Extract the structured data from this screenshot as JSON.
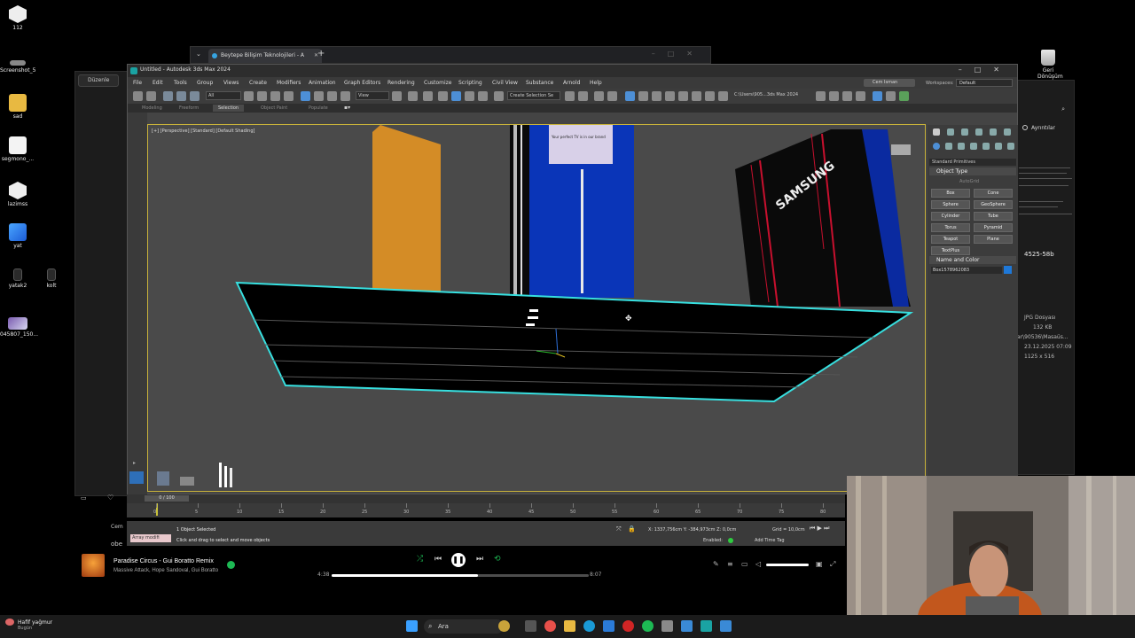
{
  "desktop": {
    "icons": [
      {
        "label": "112"
      },
      {
        "label": "Screenshot_5"
      },
      {
        "label": "sad"
      },
      {
        "label": "segmono_..."
      },
      {
        "label": "lazimss"
      },
      {
        "label": "yat"
      },
      {
        "label": "yatak2"
      },
      {
        "label": "kolt"
      },
      {
        "label": "045807_150..."
      }
    ],
    "recycle_bin": "Geri Dönüşüm"
  },
  "browser": {
    "tab_title": "Beytepe Bilişim Teknolojileri - A",
    "close": "✕",
    "new_tab": "+"
  },
  "explorer": {
    "button": "Düzenle"
  },
  "viewer": {
    "details": "Ayrıntılar",
    "size_label": "4525-58b",
    "file_type": "JPG Dosyası",
    "file_size": "132 KB",
    "path": "ar\\90536\\Masaüs...",
    "date": "23.12.2025 07:09",
    "dimensions": "1125 x 516"
  },
  "max": {
    "title": "Untitled - Autodesk 3ds Max 2024",
    "menu": [
      "File",
      "Edit",
      "Tools",
      "Group",
      "Views",
      "Create",
      "Modifiers",
      "Animation",
      "Graph Editors",
      "Rendering",
      "Customize",
      "Scripting",
      "Civil View",
      "Substance",
      "Arnold",
      "Help"
    ],
    "user": "Cem Isman",
    "workspace_label": "Workspaces:",
    "workspace_value": "Default",
    "filter_select": "All",
    "view_select": "View",
    "selection_set": "Create Selection Se",
    "path": "C:\\Users\\905...3ds Max 2024",
    "ribbon_tabs": [
      "Modeling",
      "Freeform",
      "Selection",
      "Object Paint",
      "Populate"
    ],
    "ribbon_active": "Selection",
    "viewport_label": "[+] [Perspective] [Standard] [Default Shading]",
    "scene_text": {
      "poster": "Your perfect TV is in our brand",
      "brand": "SAMSUNG"
    },
    "command_panel": {
      "dropdown": "Standard Primitives",
      "object_type": "Object Type",
      "autogrid": "AutoGrid",
      "buttons": [
        "Box",
        "Cone",
        "Sphere",
        "GeoSphere",
        "Cylinder",
        "Tube",
        "Torus",
        "Pyramid",
        "Teapot",
        "Plane",
        "TextPlus"
      ],
      "name_color": "Name and Color",
      "object_name": "Box1578962083",
      "swatch_color": "#1e78d8"
    },
    "timeline": {
      "slider": "0 / 100",
      "ticks": [
        "0",
        "5",
        "10",
        "15",
        "20",
        "25",
        "30",
        "35",
        "40",
        "45",
        "50",
        "55",
        "60",
        "65",
        "70",
        "75",
        "80"
      ]
    },
    "status": {
      "maxscript": "Array modifi",
      "selected": "1 Object Selected",
      "prompt": "Click and drag to select and move objects",
      "coords": "X: 1337,756cm  Y: -384,973cm  Z: 0,0cm",
      "grid": "Grid = 10,0cm",
      "enabled": "Enabled:",
      "add_tag": "Add Time Tag",
      "user_prefix": "Cem",
      "obj_prefix": "obe"
    }
  },
  "spotify": {
    "song": "Paradise Circus - Gui Boratto Remix",
    "artists": "Massive Attack, Hope Sandoval, Gui Boratto",
    "elapsed": "4:38",
    "duration": "8:07",
    "progress": 0.57
  },
  "taskbar": {
    "weather": "Hafif yağmur",
    "weather_sub": "Bugün",
    "search": "Ara"
  }
}
